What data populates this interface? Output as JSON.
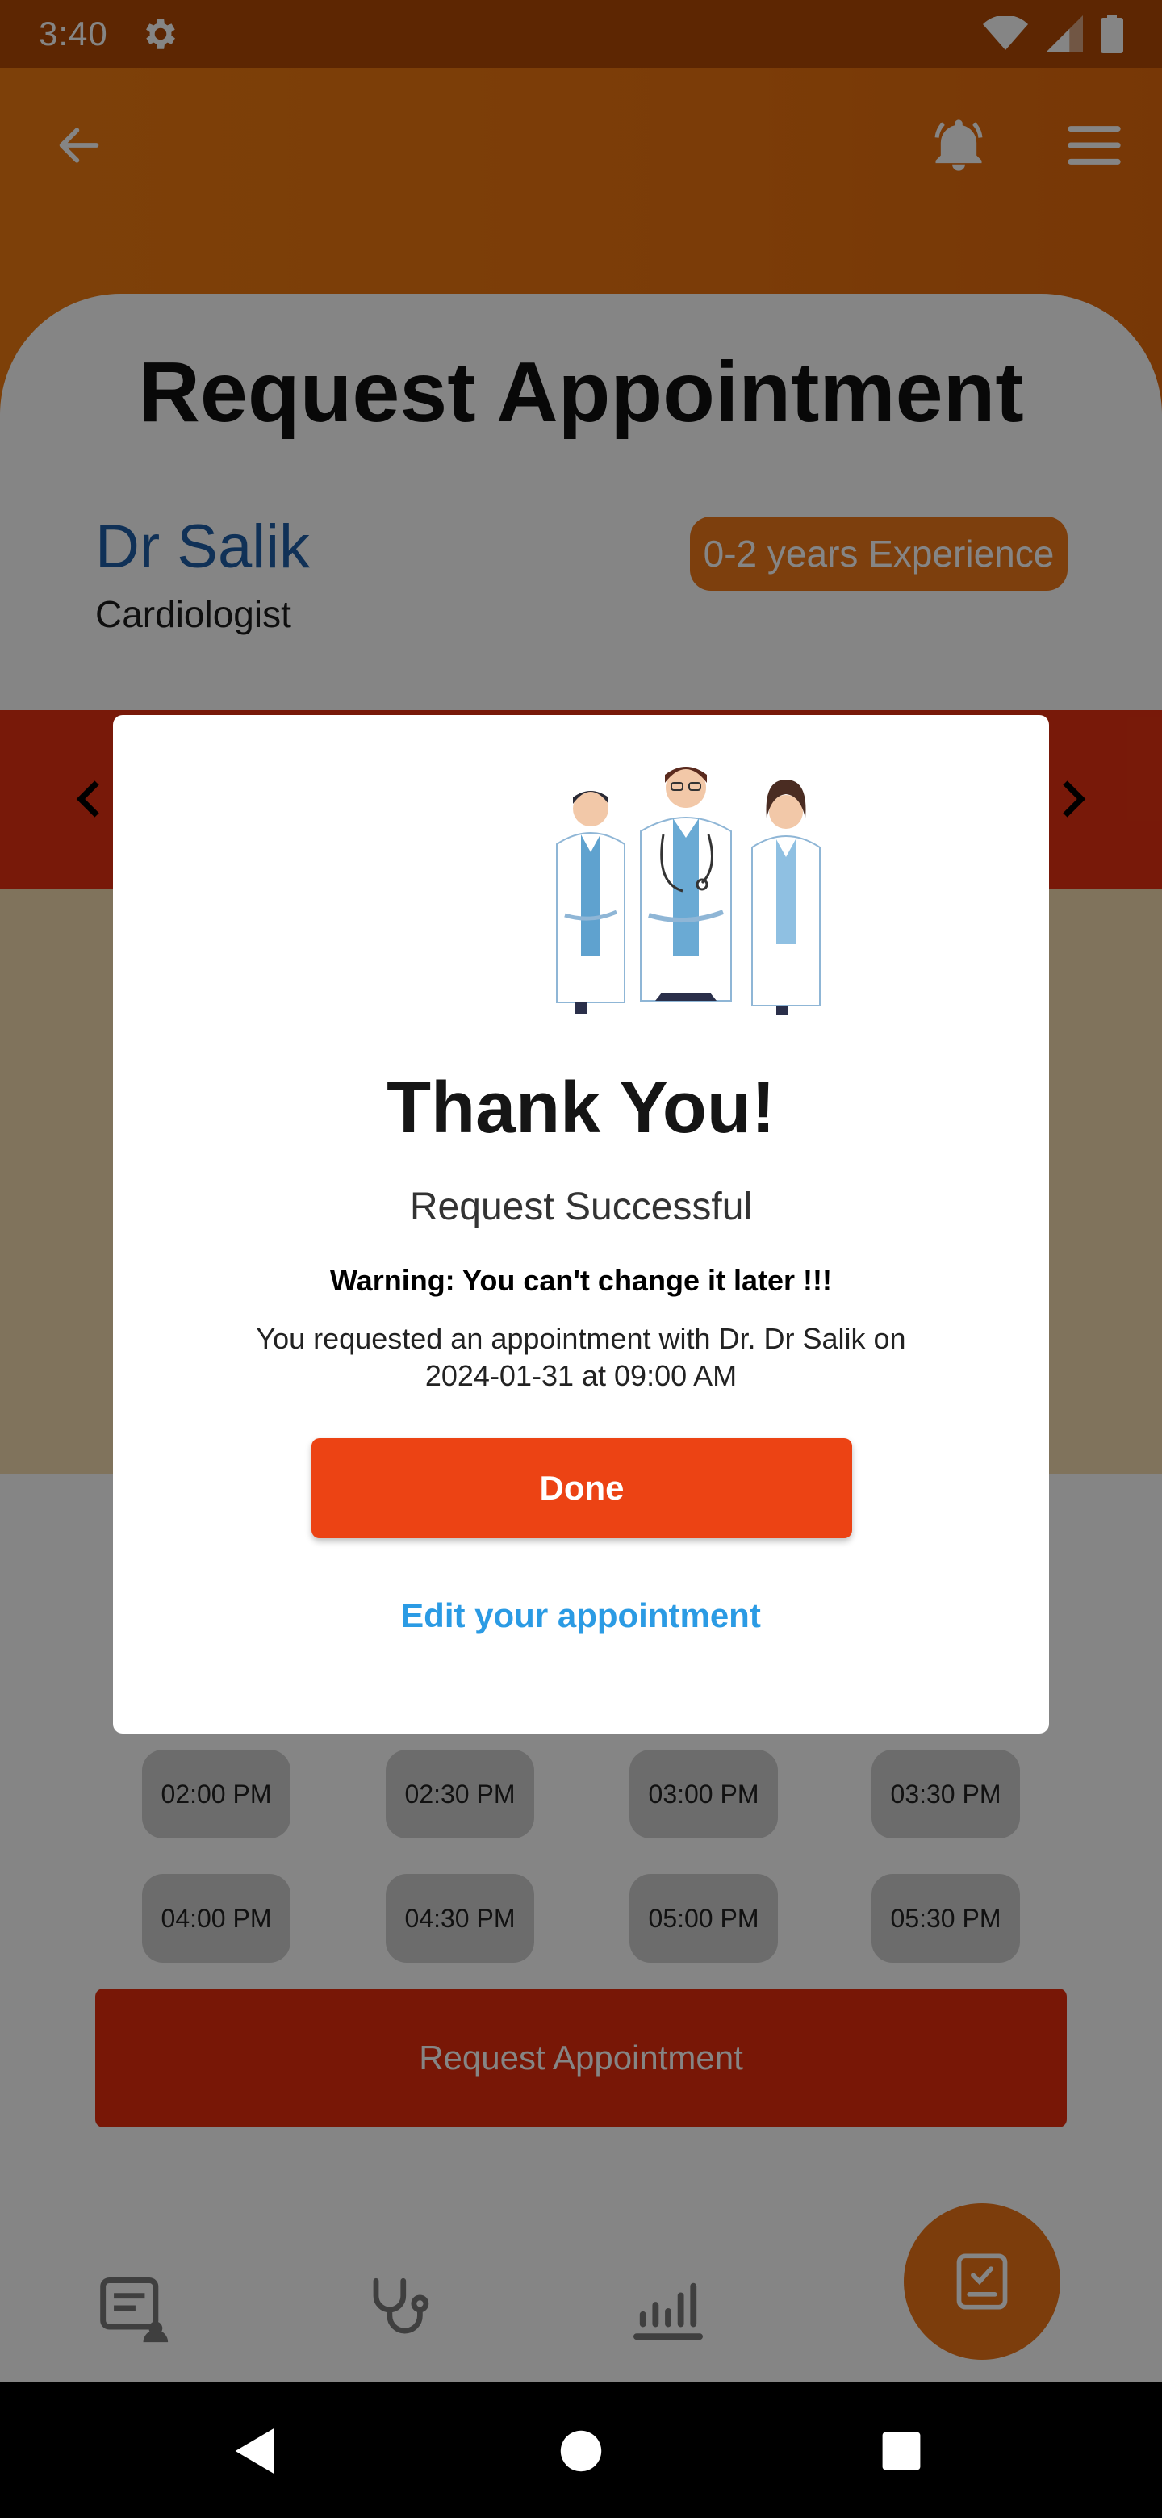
{
  "status_bar": {
    "time": "3:40"
  },
  "header": {
    "back_icon": "arrow-left-icon",
    "bell_icon": "bell-ring-icon",
    "menu_icon": "hamburger-menu-icon"
  },
  "page": {
    "title": "Request Appointment",
    "doctor_name": "Dr Salik",
    "specialty": "Cardiologist",
    "experience": "0-2 years Experience"
  },
  "time_slots": {
    "row1": [
      "02:00 PM",
      "02:30 PM",
      "03:00 PM",
      "03:30 PM"
    ],
    "row2": [
      "04:00 PM",
      "04:30 PM",
      "05:00 PM",
      "05:30 PM"
    ]
  },
  "request_button": "Request Appointment",
  "dialog": {
    "title": "Thank You!",
    "subtitle": "Request Successful",
    "warning": "Warning: You can't change it later !!!",
    "message": "You requested an appointment with Dr. Dr Salik on 2024-01-31 at 09:00 AM",
    "done_label": "Done",
    "edit_label": "Edit your appointment"
  },
  "colors": {
    "header_orange": "#f07c12",
    "date_strip_red": "#e63112",
    "done_button": "#ec4314",
    "link_blue": "#2b9be4",
    "doctor_name_blue": "#1f5fa8"
  }
}
